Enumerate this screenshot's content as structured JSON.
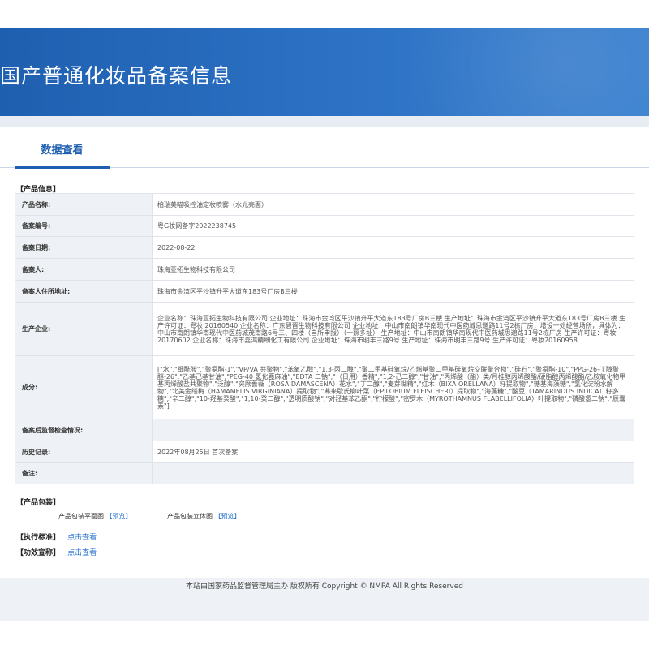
{
  "header": {
    "title": "国产普通化妆品备案信息"
  },
  "tabs": [
    {
      "label": "数据查看"
    }
  ],
  "product_info": {
    "section_title": "【产品信息】",
    "rows": [
      {
        "label": "产品名称:",
        "value": "柏瑞美喵吸控油定妆喷雾（水光亮面）"
      },
      {
        "label": "备案编号:",
        "value": "粤G妆网备字2022238745"
      },
      {
        "label": "备案日期:",
        "value": "2022-08-22"
      },
      {
        "label": "备案人:",
        "value": "珠海亚拓生物科技有限公司"
      },
      {
        "label": "备案人住所地址:",
        "value": "珠海市金湾区平沙镇升平大道东183号厂房B三楼"
      },
      {
        "label": "生产企业:",
        "value": "企业名称：珠海亚拓生物科技有限公司 企业地址：珠海市金湾区平沙镇升平大道东183号厂房B三楼 生产地址：珠海市金湾区平沙镇升平大道东183号厂房B三楼 生产许可证：粤妆 20160540 企业名称：广东碧晋生物科技有限公司 企业地址：中山市南朗镇华南现代中医药城思邈路11号2栋厂房，增设一处经营场所，具体为：中山市南朗镇华南现代中医药城茂南路6号三、四楼（自所申报）（一照多址） 生产地址：中山市南朗镇华南现代中医药城思邈路11号2栋厂房 生产许可证：粤妆20170602 企业名称：珠海市嘉鸿精细化工有限公司 企业地址：珠海市明丰三路9号 生产地址：珠海市明丰三路9号 生产许可证：粤妆20160958"
      },
      {
        "label": "成分:",
        "value": "[\"水\",\"细酰胺\",\"聚氨酯-1\",\"VP/VA 共聚物\",\"苯氧乙醇\",\"1,3-丙二醇\",\"聚二甲基硅氧烷/乙烯基聚二甲基硅氧烷交联聚合物\",\"硅石\",\"聚氨酯-10\",\"PPG-26-丁醇聚醚-26\",\"乙基己基甘油\",\"PEG-40 氢化蓖麻油\",\"EDTA 二钠\",\"（日用）香精\",\"1,2-己二醇\",\"甘油\",\"丙烯酸（酯）类/月桂醇丙烯酸酯/硬脂醇丙烯酸酯/乙胺氧化物甲基丙烯酸盐共聚物\",\"泛醇\",\"突厥蔷薇（ROSA DAMASCENA）花水\",\"丁二醇\",\"麦芽糊精\",\"红木（BIXA ORELLANA）籽提取物\",\"糖基海藻糖\",\"氢化淀粉水解物\",\"北美金缕梅（HAMAMELIS VIRGINIANA）提取物\",\"弗来歇氏柳叶菜（EPILOBIUM FLEISCHERI）提取物\",\"海藻糖\",\"酸豆（TAMARINDUS INDICA）籽多糖\",\"辛二醇\",\"10-羟基癸酸\",\"1,10-癸二醇\",\"透明质酸钠\",\"对羟基苯乙酮\",\"柠檬酸\",\"密罗木（MYROTHAMNUS FLABELLIFOLIA）叶提取物\",\"磷酸氢二钠\",\"辰囊素\"]"
      },
      {
        "label": "备案后监督检查情况:",
        "value": ""
      },
      {
        "label": "历史记录:",
        "value": "2022年08月25日 首次备案"
      },
      {
        "label": "备注:",
        "value": ""
      }
    ]
  },
  "packaging": {
    "section_title": "【产品包装】",
    "items": [
      {
        "label": "产品包装平面图",
        "link_label": "【预览】"
      },
      {
        "label": "产品包装立体图",
        "link_label": "【预览】"
      }
    ]
  },
  "standard": {
    "section_title": "【执行标准】",
    "link_label": "点击查看"
  },
  "efficacy": {
    "section_title": "【功效宣称】",
    "link_label": "点击查看"
  },
  "footer": {
    "text": "本站由国家药品监督管理局主办 版权所有 Copyright © NMPA All Rights Reserved"
  },
  "colors": {
    "brand": "#1f5fb0",
    "link": "#1f6fd0",
    "label_bg": "#eef1f5"
  }
}
